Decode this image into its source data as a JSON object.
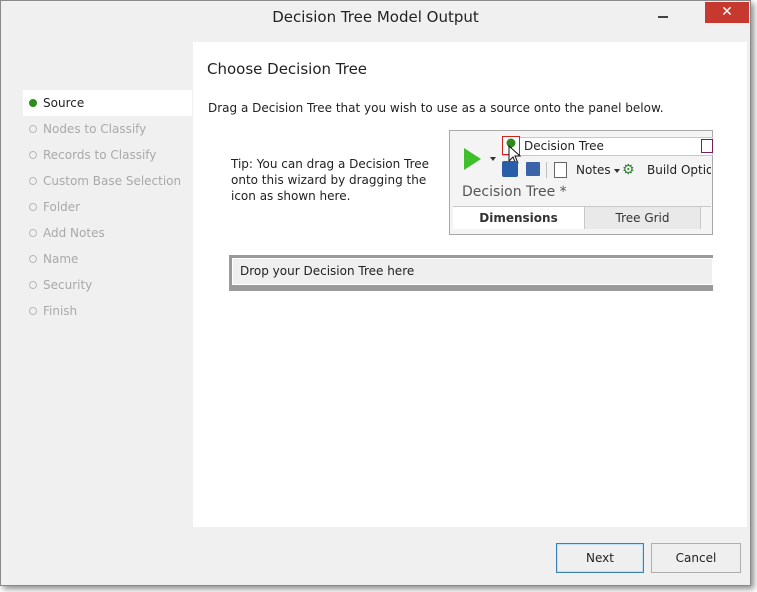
{
  "window": {
    "title": "Decision Tree Model Output",
    "close_glyph": "✕"
  },
  "sidebar": {
    "items": [
      {
        "label": "Source",
        "active": true
      },
      {
        "label": "Nodes to Classify",
        "active": false
      },
      {
        "label": "Records to Classify",
        "active": false
      },
      {
        "label": "Custom Base Selection",
        "active": false
      },
      {
        "label": "Folder",
        "active": false
      },
      {
        "label": "Add Notes",
        "active": false
      },
      {
        "label": "Name",
        "active": false
      },
      {
        "label": "Security",
        "active": false
      },
      {
        "label": "Finish",
        "active": false
      }
    ],
    "active_color": "#2e8b1e"
  },
  "main": {
    "heading": "Choose Decision Tree",
    "instruction": "Drag a Decision Tree that you wish to use as a source onto the panel below.",
    "tip": "Tip: You can drag a Decision Tree onto this wizard by dragging the icon as shown here.",
    "preview": {
      "tree_name": "Decision Tree",
      "notes_label": "Notes",
      "build_label": "Build Options",
      "tree_title": "Decision Tree *",
      "tabs": [
        "Dimensions",
        "Tree Grid"
      ],
      "icons": [
        "play-icon",
        "tree-node-icon",
        "lock-icon",
        "save-icon",
        "notes-icon",
        "gears-icon",
        "cursor-icon"
      ]
    },
    "drop_zone": "Drop your Decision Tree here"
  },
  "footer": {
    "next_label": "Next",
    "cancel_label": "Cancel"
  },
  "colors": {
    "close_button": "#c7392e",
    "play_green": "#3fbf2b",
    "focus_border": "#3c7fb1"
  }
}
